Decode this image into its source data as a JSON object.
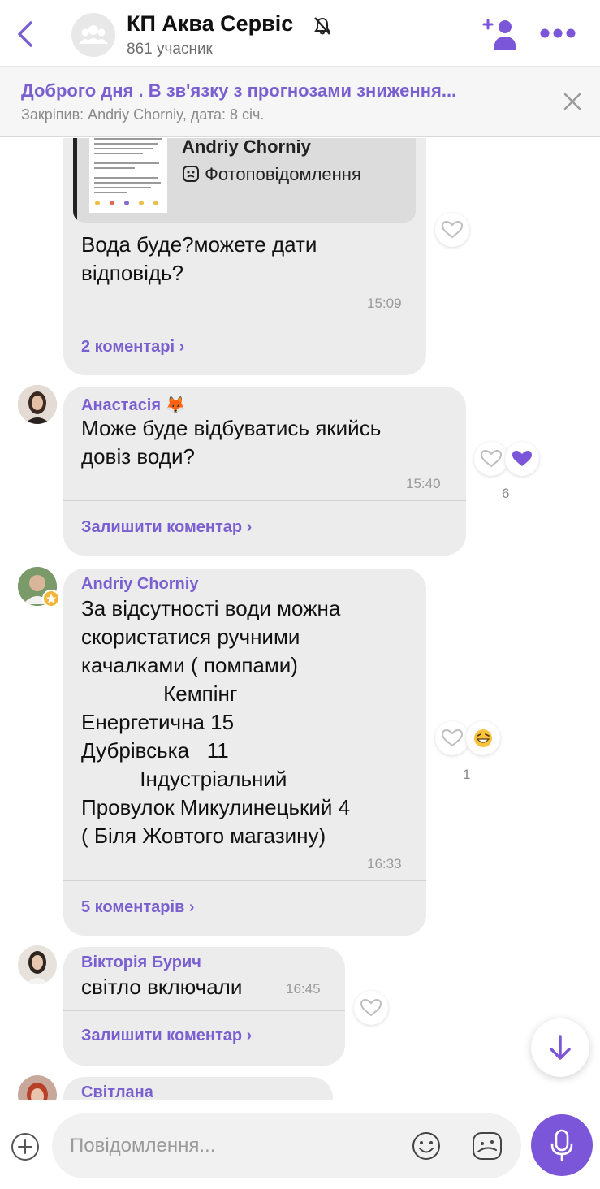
{
  "header": {
    "title": "КП Аква Сервіс",
    "members": "861 учасник"
  },
  "pinned": {
    "text": "Доброго дня .  В зв'язку з прогнозами зниження...",
    "meta": "Закріпив: Andriy Chorniy, дата: 8 січ."
  },
  "messages": [
    {
      "reply": {
        "author": "Andriy Chorniy",
        "type": "Фотоповідомлення"
      },
      "text_lines": [
        "Вода буде?можете дати",
        "відповідь?"
      ],
      "time": "15:09",
      "comments": "2 коментарі ›"
    },
    {
      "sender": "Анастасія 🦊",
      "text_lines": [
        "Може буде відбуватись якийсь",
        "довіз води?"
      ],
      "time": "15:40",
      "comments": "Залишити коментар ›",
      "reaction_count": "6"
    },
    {
      "sender": "Andriy Chorniy",
      "text_lines": [
        "За відсутності води можна",
        "скористатися ручними",
        "качалками ( помпами)",
        "              Кемпінг",
        "Енергетична 15",
        "Дубрівська   11",
        "          Індустріальний",
        "Провулок Микулинецький 4",
        "( Біля Жовтого магазину)"
      ],
      "time": "16:33",
      "comments": "5 коментарів ›",
      "reaction_count": "1"
    },
    {
      "sender": "Вікторія Бурич",
      "text_lines": [
        "світло включали"
      ],
      "time": "16:45",
      "comments": "Залишити коментар ›"
    },
    {
      "sender": "Світлана"
    }
  ],
  "composer": {
    "placeholder": "Повідомлення..."
  },
  "colors": {
    "accent": "#7a5fd0",
    "mic": "#7c56d8",
    "bubble": "#ececec"
  }
}
